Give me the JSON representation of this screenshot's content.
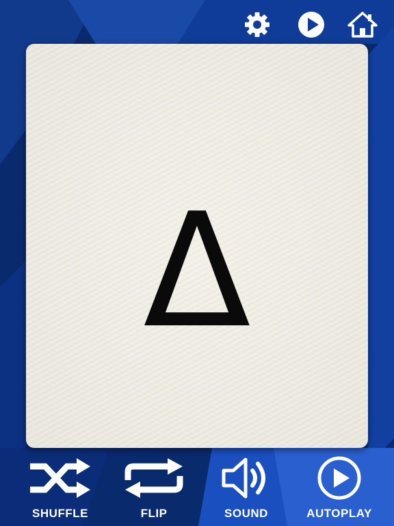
{
  "theme": {
    "background": "#0a2a6e",
    "accent": "#1d56c9",
    "card": "#f1efe6",
    "icon": "#ffffff",
    "symbol": "#0a0a0a"
  },
  "topbar": {
    "buttons": [
      {
        "icon": "gear-icon"
      },
      {
        "icon": "play-icon"
      },
      {
        "icon": "home-icon"
      }
    ]
  },
  "card": {
    "symbol": "Δ"
  },
  "bottombar": {
    "buttons": [
      {
        "icon": "shuffle-icon",
        "label": "SHUFFLE"
      },
      {
        "icon": "flip-icon",
        "label": "FLIP"
      },
      {
        "icon": "sound-icon",
        "label": "SOUND"
      },
      {
        "icon": "autoplay-icon",
        "label": "AUTOPLAY"
      }
    ]
  }
}
